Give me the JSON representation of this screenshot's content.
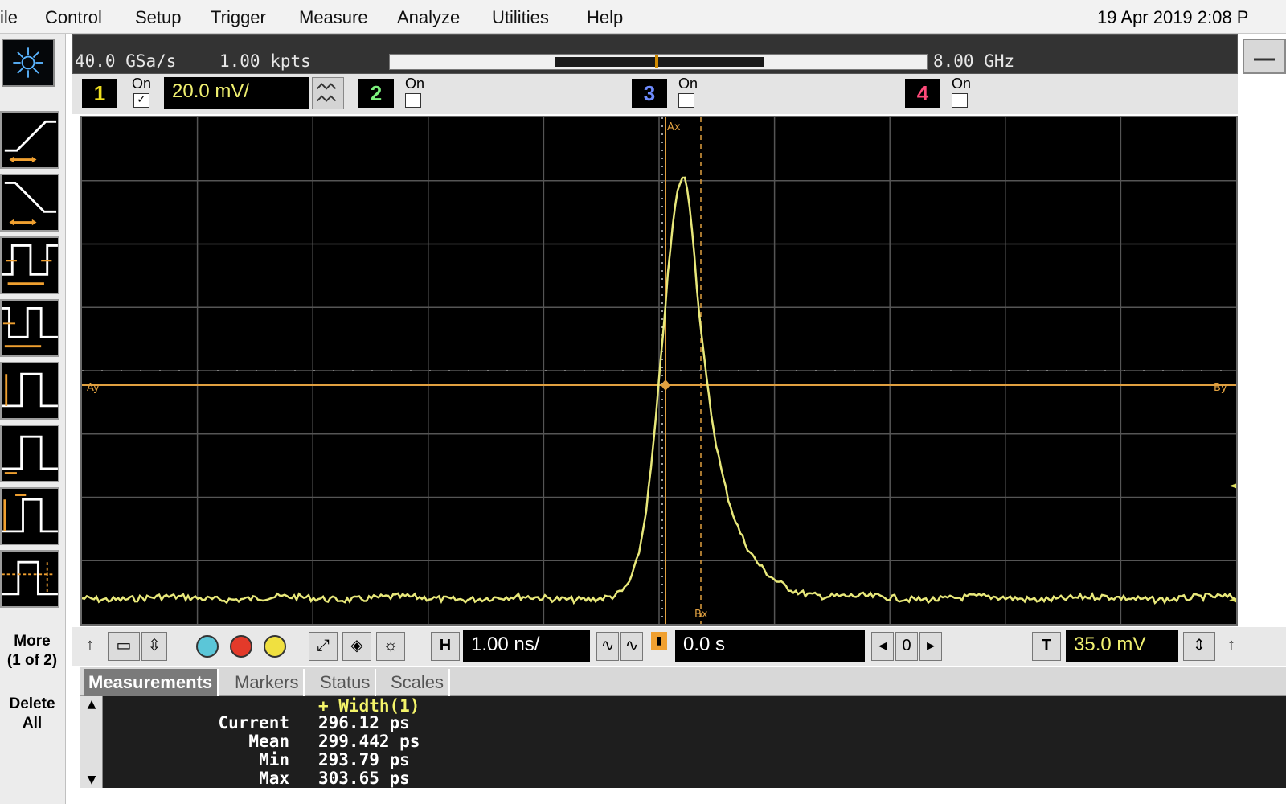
{
  "menu": {
    "items": [
      "ile",
      "Control",
      "Setup",
      "Trigger",
      "Measure",
      "Analyze",
      "Utilities",
      "Help"
    ],
    "datetime": "19 Apr 2019  2:08 P"
  },
  "acquisition": {
    "sample_rate": "40.0 GSa/s",
    "points": "1.00 kpts",
    "bandwidth": "8.00 GHz"
  },
  "channels": [
    {
      "number": "1",
      "on_label": "On",
      "checked": "✓",
      "color": "#f0e020"
    },
    {
      "number": "2",
      "on_label": "On",
      "checked": "",
      "color": "#7cf07c"
    },
    {
      "number": "3",
      "on_label": "On",
      "checked": "",
      "color": "#6f8cff"
    },
    {
      "number": "4",
      "on_label": "On",
      "checked": "",
      "color": "#ff4a7a"
    }
  ],
  "vertical_scale": "20.0 mV/",
  "horizontal": {
    "scale": "1.00 ns/",
    "position": "0.0 s"
  },
  "trigger_level": "35.0 mV",
  "sidebar": {
    "more_label": "More\n(1 of 2)",
    "delete_label": "Delete\nAll"
  },
  "markers": {
    "ax": "Ax",
    "bx": "Bx",
    "ay": "Ay",
    "by": "By"
  },
  "tabs": [
    "Measurements",
    "Markers",
    "Status",
    "Scales"
  ],
  "measurements": {
    "title": "+ Width(1)",
    "rows": [
      {
        "label": "Current",
        "value": "296.12 ps"
      },
      {
        "label": "Mean",
        "value": "299.442 ps"
      },
      {
        "label": "Min",
        "value": "293.79 ps"
      },
      {
        "label": "Max",
        "value": "303.65 ps"
      }
    ]
  },
  "colors": {
    "trace": "#e8e87a",
    "marker": "#e0a040",
    "graticule": "#555555"
  }
}
